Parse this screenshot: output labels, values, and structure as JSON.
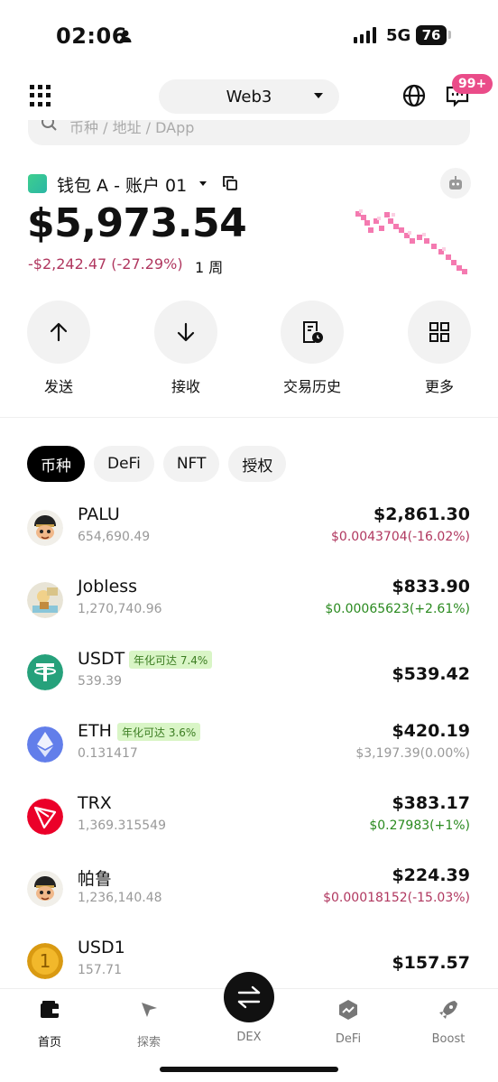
{
  "status_bar": {
    "time": "02:06",
    "network": "5G",
    "battery": "76"
  },
  "header": {
    "network_selector": "Web3",
    "notification_badge": "99+"
  },
  "search": {
    "placeholder": "币种 / 地址 / DApp"
  },
  "wallet": {
    "name": "钱包 A - 账户 01",
    "balance": "$5,973.54",
    "change": "-$2,242.47 (-27.29%)",
    "period": "1 周"
  },
  "actions": [
    {
      "label": "发送",
      "icon": "arrow-up-icon"
    },
    {
      "label": "接收",
      "icon": "arrow-down-icon"
    },
    {
      "label": "交易历史",
      "icon": "history-icon"
    },
    {
      "label": "更多",
      "icon": "grid-icon"
    }
  ],
  "tabs": [
    {
      "label": "币种",
      "active": true
    },
    {
      "label": "DeFi",
      "active": false
    },
    {
      "label": "NFT",
      "active": false
    },
    {
      "label": "授权",
      "active": false
    }
  ],
  "tokens": [
    {
      "name": "PALU",
      "amount": "654,690.49",
      "value": "$2,861.30",
      "delta": "$0.0043704(-16.02%)",
      "delta_color": "#b0375f",
      "apy": ""
    },
    {
      "name": "Jobless",
      "amount": "1,270,740.96",
      "value": "$833.90",
      "delta": "$0.00065623(+2.61%)",
      "delta_color": "#2a8a1f",
      "apy": ""
    },
    {
      "name": "USDT",
      "amount": "539.39",
      "value": "$539.42",
      "delta": "",
      "delta_color": "",
      "apy": "年化可达 7.4%"
    },
    {
      "name": "ETH",
      "amount": "0.131417",
      "value": "$420.19",
      "delta": "$3,197.39(0.00%)",
      "delta_color": "#999999",
      "apy": "年化可达 3.6%"
    },
    {
      "name": "TRX",
      "amount": "1,369.315549",
      "value": "$383.17",
      "delta": "$0.27983(+1%)",
      "delta_color": "#2a8a1f",
      "apy": ""
    },
    {
      "name": "帕鲁",
      "amount": "1,236,140.48",
      "value": "$224.39",
      "delta": "$0.00018152(-15.03%)",
      "delta_color": "#b0375f",
      "apy": ""
    },
    {
      "name": "USD1",
      "amount": "157.71",
      "value": "$157.57",
      "delta": "",
      "delta_color": "",
      "apy": ""
    }
  ],
  "bottom_nav": [
    {
      "label": "首页",
      "icon": "wallet-icon",
      "active": true
    },
    {
      "label": "探索",
      "icon": "compass-icon",
      "active": false
    },
    {
      "label": "DEX",
      "icon": "swap-icon",
      "active": false
    },
    {
      "label": "DeFi",
      "icon": "defi-icon",
      "active": false
    },
    {
      "label": "Boost",
      "icon": "rocket-icon",
      "active": false
    }
  ],
  "colors": {
    "negative": "#b0375f",
    "positive": "#2a8a1f",
    "accent_badge": "#ea4c89",
    "sparkline": "#f47ab0",
    "apy_bg": "#d9f5c6"
  }
}
